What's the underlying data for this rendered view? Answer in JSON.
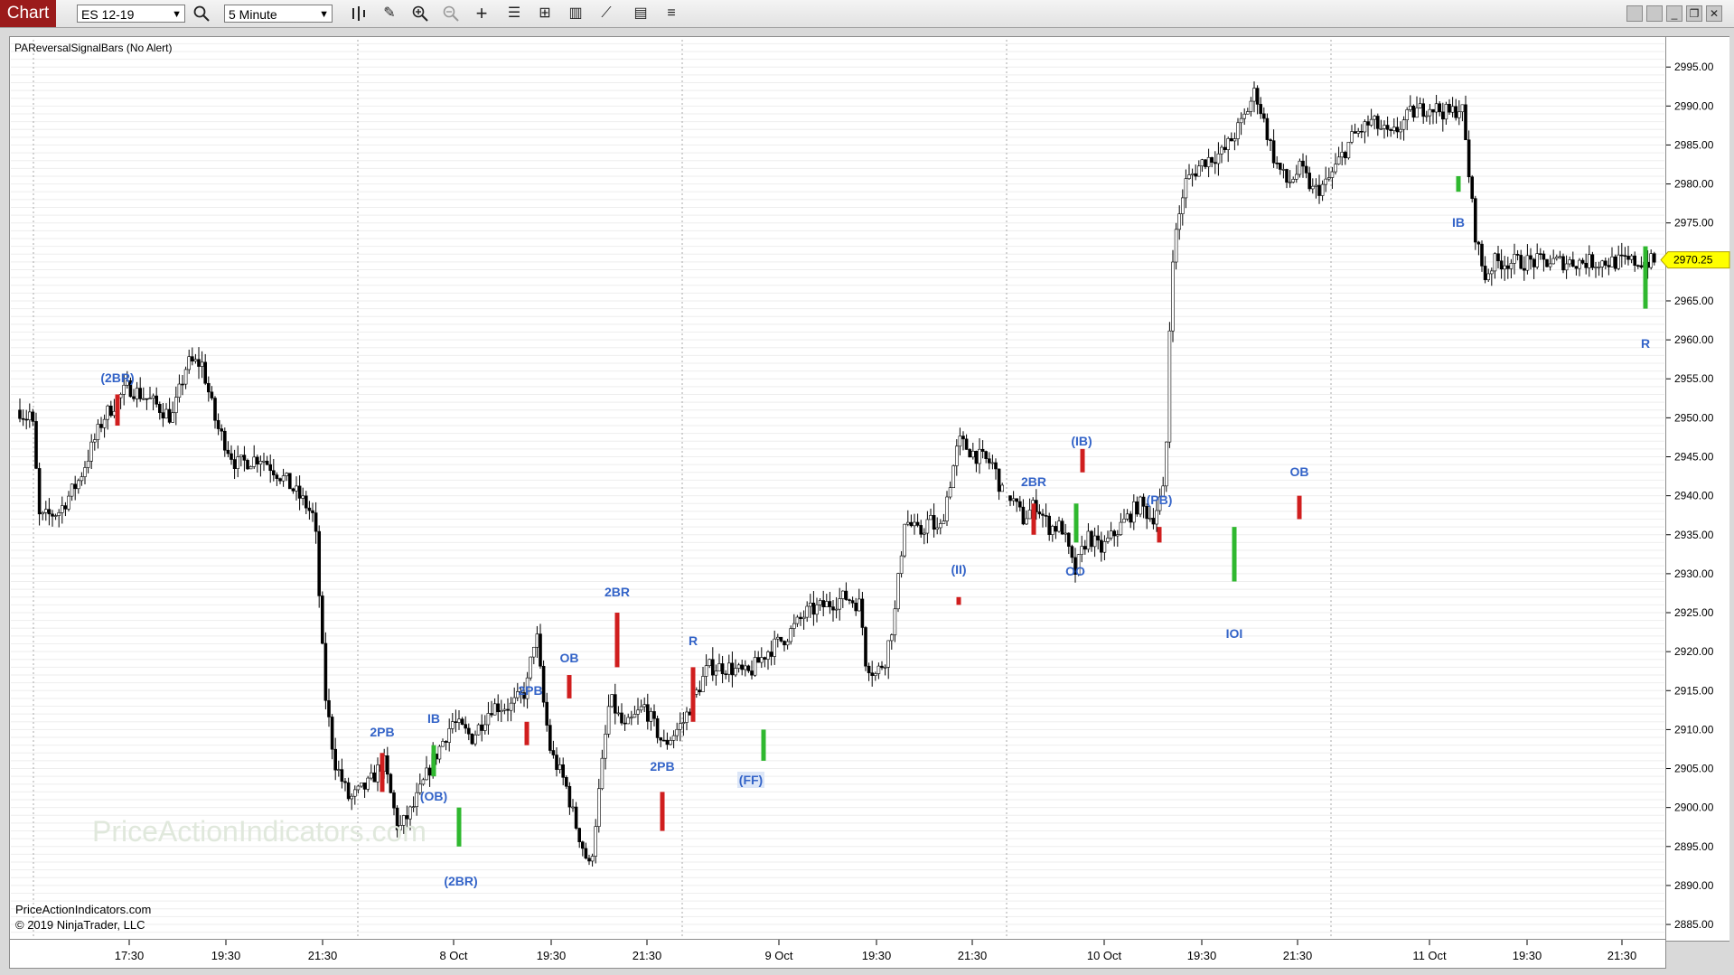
{
  "toolbar": {
    "chart_tab": "Chart",
    "instrument": "ES 12-19",
    "interval": "5 Minute",
    "icons": [
      "search-icon",
      "bar-style-icon",
      "draw-pencil-icon",
      "zoom-in-icon",
      "zoom-out-icon",
      "crosshair-icon",
      "properties-icon",
      "strategies-icon",
      "indicators-icon",
      "chart-trader-icon",
      "data-box-icon",
      "menu-icon"
    ]
  },
  "window_controls": [
    "tile-icon",
    "tile-icon",
    "minimize-icon",
    "restore-icon",
    "close-icon"
  ],
  "indicator_label": "PAReversalSignalBars (No Alert)",
  "watermark": "PriceActionIndicators.com",
  "copyright": {
    "line1": "PriceActionIndicators.com",
    "line2": "© 2019 NinjaTrader, LLC"
  },
  "colors": {
    "up_signal": "#2fb82f",
    "down_signal": "#d01e1e",
    "label": "#3464c8",
    "last_price_bg": "#ffff00",
    "tab_bg": "#9b1b1b"
  },
  "chart_data": {
    "type": "candlestick",
    "instrument": "ES 12-19",
    "y_ticks": [
      "2995.00",
      "2990.00",
      "2985.00",
      "2980.00",
      "2975.00",
      "2970.00",
      "2965.00",
      "2960.00",
      "2955.00",
      "2950.00",
      "2945.00",
      "2940.00",
      "2935.00",
      "2930.00",
      "2925.00",
      "2920.00",
      "2915.00",
      "2910.00",
      "2905.00",
      "2900.00",
      "2895.00",
      "2890.00",
      "2885.00"
    ],
    "y_range": [
      2883.5,
      2998.5
    ],
    "last_price": "2970.25",
    "x_ticks": [
      "17:30",
      "19:30",
      "21:30",
      "8 Oct",
      "19:30",
      "21:30",
      "9 Oct",
      "19:30",
      "21:30",
      "10 Oct",
      "19:30",
      "21:30",
      "11 Oct",
      "19:30",
      "21:30"
    ],
    "session_path": [
      [
        0,
        2951
      ],
      [
        0.006,
        2950
      ],
      [
        0.012,
        2951
      ],
      [
        0.02,
        2937
      ],
      [
        0.04,
        2938
      ],
      [
        0.06,
        2942
      ],
      [
        0.085,
        2950
      ],
      [
        0.11,
        2954
      ],
      [
        0.135,
        2952
      ],
      [
        0.155,
        2950
      ],
      [
        0.17,
        2957
      ],
      [
        0.185,
        2957
      ],
      [
        0.2,
        2949
      ],
      [
        0.22,
        2944
      ],
      [
        0.245,
        2945
      ],
      [
        0.27,
        2942
      ],
      [
        0.29,
        2939
      ],
      [
        0.3,
        2937
      ],
      [
        0.31,
        2915
      ],
      [
        0.32,
        2906
      ],
      [
        0.335,
        2901
      ],
      [
        0.355,
        2903
      ],
      [
        0.37,
        2906
      ],
      [
        0.385,
        2897
      ],
      [
        0.4,
        2900
      ],
      [
        0.42,
        2906
      ],
      [
        0.44,
        2911
      ],
      [
        0.46,
        2909
      ],
      [
        0.48,
        2913
      ],
      [
        0.5,
        2913
      ],
      [
        0.515,
        2915
      ],
      [
        0.525,
        2923
      ],
      [
        0.532,
        2914
      ],
      [
        0.54,
        2907
      ],
      [
        0.555,
        2903
      ],
      [
        0.565,
        2898
      ],
      [
        0.58,
        2892
      ],
      [
        0.6,
        2914
      ],
      [
        0.615,
        2910
      ],
      [
        0.635,
        2913
      ],
      [
        0.655,
        2908
      ],
      [
        0.675,
        2911
      ],
      [
        0.7,
        2918
      ],
      [
        0.72,
        2918
      ],
      [
        0.74,
        2917
      ],
      [
        0.76,
        2920
      ],
      [
        0.78,
        2922
      ],
      [
        0.8,
        2925
      ],
      [
        0.82,
        2926
      ],
      [
        0.84,
        2927
      ],
      [
        0.855,
        2926
      ],
      [
        0.86,
        2919
      ],
      [
        0.87,
        2917
      ],
      [
        0.88,
        2919
      ],
      [
        0.89,
        2925
      ],
      [
        0.9,
        2937
      ],
      [
        0.915,
        2935
      ],
      [
        0.925,
        2937
      ],
      [
        0.935,
        2935
      ],
      [
        0.945,
        2941
      ],
      [
        0.955,
        2947
      ],
      [
        0.975,
        2945
      ],
      [
        0.99,
        2944
      ],
      [
        1.0,
        2940
      ]
    ],
    "session_path_2": [
      [
        0,
        2940
      ],
      [
        0.02,
        2937
      ],
      [
        0.04,
        2939
      ],
      [
        0.06,
        2936
      ],
      [
        0.08,
        2936
      ],
      [
        0.1,
        2930
      ],
      [
        0.12,
        2935
      ],
      [
        0.14,
        2933
      ],
      [
        0.16,
        2935
      ],
      [
        0.18,
        2937
      ],
      [
        0.2,
        2939
      ],
      [
        0.22,
        2937
      ],
      [
        0.24,
        2941
      ],
      [
        0.25,
        2970
      ],
      [
        0.27,
        2980
      ],
      [
        0.3,
        2983
      ],
      [
        0.33,
        2984
      ],
      [
        0.36,
        2988
      ],
      [
        0.38,
        2992
      ],
      [
        0.39,
        2989
      ],
      [
        0.41,
        2983
      ],
      [
        0.43,
        2980
      ],
      [
        0.45,
        2982
      ],
      [
        0.47,
        2979
      ],
      [
        0.49,
        2980
      ],
      [
        0.51,
        2983
      ],
      [
        0.53,
        2986
      ],
      [
        0.56,
        2988
      ],
      [
        0.59,
        2986
      ],
      [
        0.62,
        2989
      ],
      [
        0.65,
        2990
      ],
      [
        0.68,
        2989
      ],
      [
        0.7,
        2990
      ],
      [
        0.71,
        2982
      ],
      [
        0.72,
        2974
      ],
      [
        0.735,
        2968
      ],
      [
        0.75,
        2970
      ]
    ],
    "signal_labels": [
      "(2BR)",
      "2PB",
      "IB",
      "(OB)",
      "(2BR)",
      "2PB",
      "OB",
      "2BR",
      "2PB",
      "R",
      "(FF)",
      "(II)",
      "2BR",
      "(IB)",
      "OO",
      "(PB)",
      "IOI",
      "OB",
      "IB",
      "R"
    ]
  }
}
